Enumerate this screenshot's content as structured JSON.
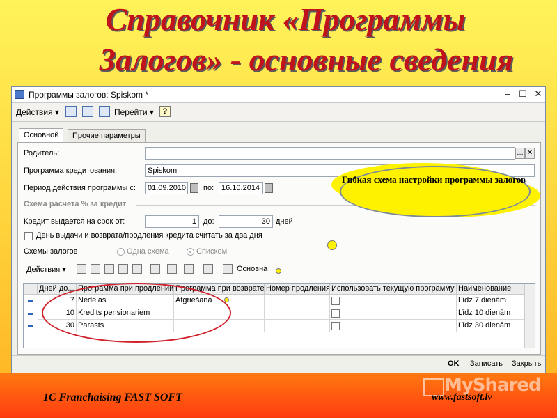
{
  "slide": {
    "title_line1": "Справочник  «Программы",
    "title_line2": "Залогов» - основные сведения",
    "footer_left": "1C Franchaising FAST SOFT",
    "footer_right": "www.fastsoft.lv",
    "watermark": "MyShared",
    "callout": "Гибкая схема настройки программы залогов"
  },
  "window": {
    "title": "Программы залогов: Spiskom *",
    "controls": [
      "–",
      "☐",
      "✕"
    ]
  },
  "toolbar": {
    "actions": "Действия ▾",
    "goto": "Перейти ▾",
    "help": "?"
  },
  "tabs": {
    "main": "Основной",
    "other": "Прочие параметры"
  },
  "form": {
    "parent_label": "Родитель:",
    "parent_value": "",
    "program_label": "Программа кредитования:",
    "program_value": "Spiskom",
    "period_label": "Период действия программы с:",
    "period_from": "01.09.2010",
    "period_to_label": "по:",
    "period_to": "16.10.2014",
    "calc_header": "Схема расчета % за кредит",
    "credit_label": "Кредит выдается на срок от:",
    "credit_from": "1",
    "credit_to_label": "до:",
    "credit_to": "30",
    "days_label": "дней",
    "oneday_label": "День выдачи и возврата/продления кредита считать за два дня",
    "schemes_label": "Схемы залогов",
    "radio_one": "Одна схема",
    "radio_list": "Списком"
  },
  "grid_toolbar": {
    "actions": "Действия ▾",
    "main_label": "Основна"
  },
  "grid": {
    "headers": [
      "Дней до...",
      "Программа при продлении",
      "Программа при возврате",
      "Номер продления",
      "Использовать текущую программу",
      "Наименование"
    ],
    "rows": [
      {
        "days": "7",
        "prolong": "Nedelas",
        "return": "Atgriešana",
        "number": "",
        "name": "Līdz 7 dienām"
      },
      {
        "days": "10",
        "prolong": "Kredits pensionariem",
        "return": "",
        "number": "",
        "name": "Līdz 10 dienām"
      },
      {
        "days": "30",
        "prolong": "Parasts",
        "return": "",
        "number": "",
        "name": "Līdz 30 dienām"
      }
    ]
  },
  "footer_buttons": {
    "ok": "OK",
    "save": "Записать",
    "close": "Закрыть"
  },
  "colors": {
    "title_red": "#c0131b",
    "callout_yellow": "#fff200",
    "ellipse_red": "#d0202a"
  }
}
